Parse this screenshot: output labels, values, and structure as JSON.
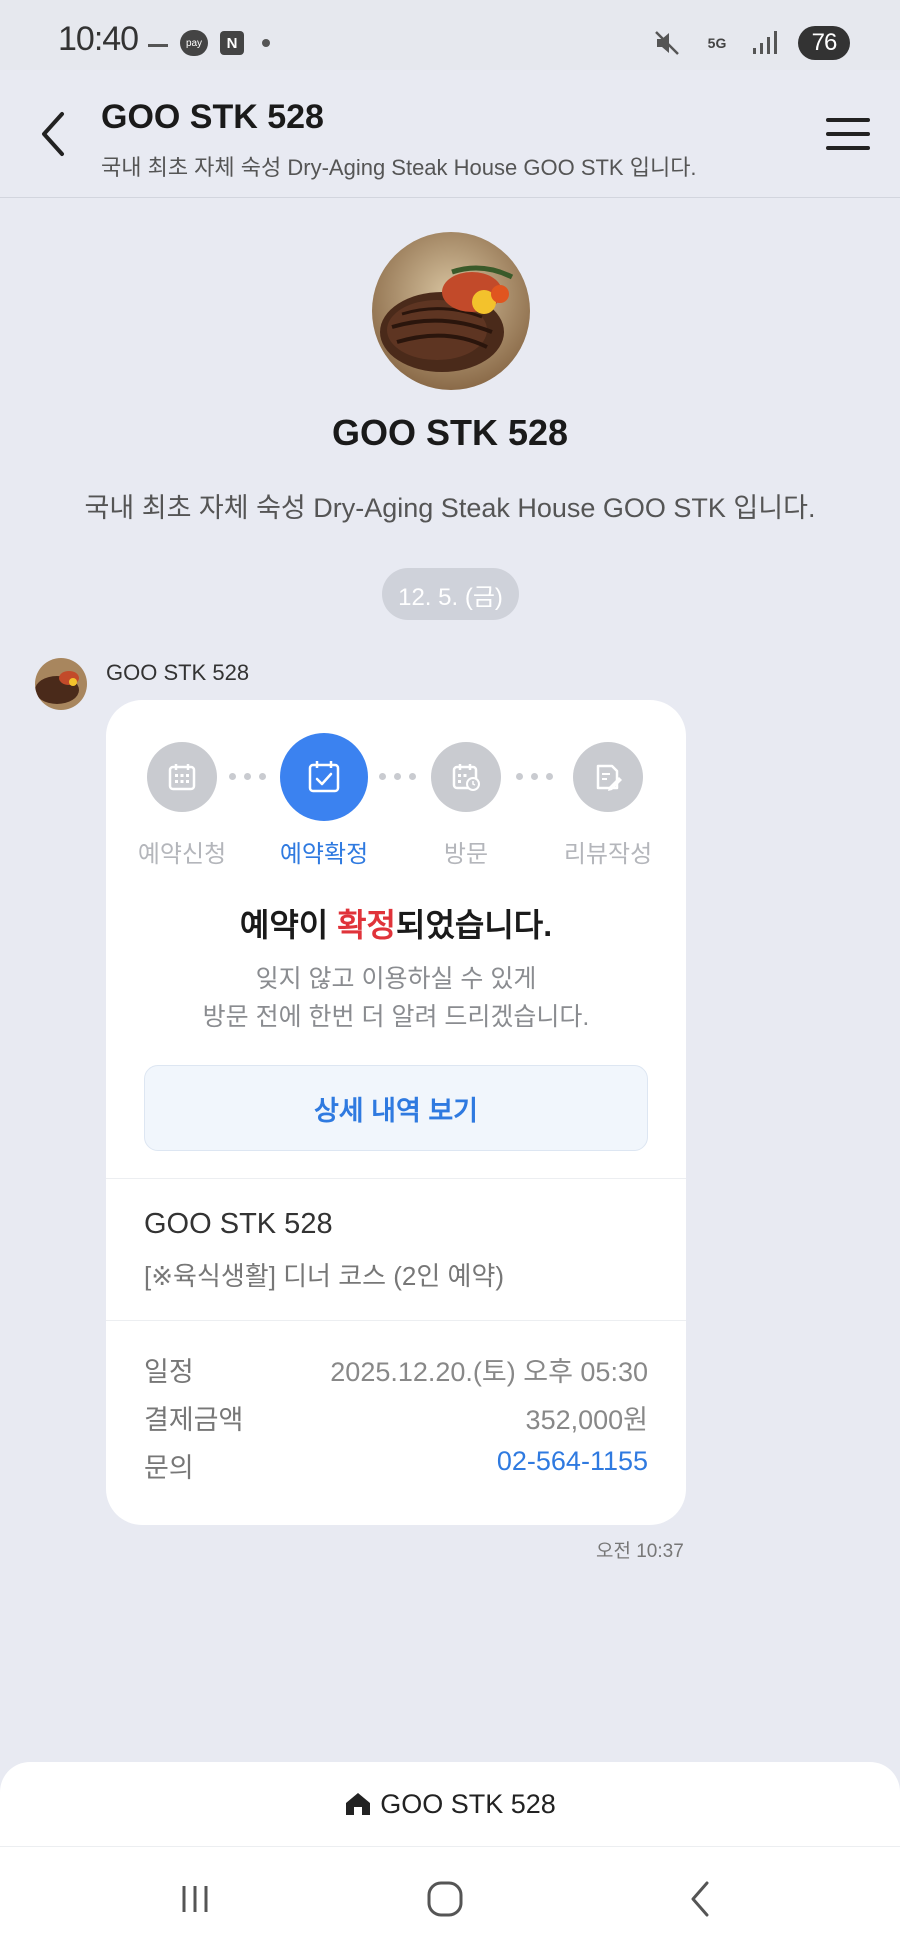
{
  "status_bar": {
    "time": "10:40",
    "pay_label": "pay",
    "n_label": "N",
    "network": "5G",
    "battery": "76",
    "icons": [
      "dash-icon",
      "pay-icon",
      "naver-icon",
      "dot-icon",
      "mute-icon",
      "5g-icon",
      "signal-icon",
      "battery-icon"
    ]
  },
  "header": {
    "title": "GOO STK 528",
    "subtitle": "국내 최초 자체 숙성 Dry-Aging Steak House GOO STK 입니다.",
    "back_icon": "back-arrow-icon",
    "menu_icon": "hamburger-menu-icon"
  },
  "profile": {
    "name": "GOO STK 528",
    "description": "국내 최초 자체 숙성 Dry-Aging Steak House GOO STK 입니다."
  },
  "date_separator": "12. 5. (금)",
  "message": {
    "sender": "GOO STK 528",
    "time": "오전 10:37",
    "steps": [
      {
        "label": "예약신청",
        "icon": "calendar-icon",
        "active": false
      },
      {
        "label": "예약확정",
        "icon": "calendar-check-icon",
        "active": true
      },
      {
        "label": "방문",
        "icon": "calendar-clock-icon",
        "active": false
      },
      {
        "label": "리뷰작성",
        "icon": "edit-note-icon",
        "active": false
      }
    ],
    "title_pre": "예약이 ",
    "title_highlight": "확정",
    "title_post": "되었습니다.",
    "body_line1": "잊지 않고 이용하실 수 있게",
    "body_line2": "방문 전에 한번 더 알려 드리겠습니다.",
    "detail_button": "상세 내역 보기",
    "business_name": "GOO STK 528",
    "course": "[※육식생활] 디너 코스 (2인 예약)",
    "info": [
      {
        "key": "일정",
        "value": "2025.12.20.(토) 오후 05:30"
      },
      {
        "key": "결제금액",
        "value": "352,000원"
      },
      {
        "key": "문의",
        "value": "02-564-1155"
      }
    ]
  },
  "bottom_bar": {
    "label": "GOO STK 528",
    "icon": "home-icon"
  },
  "colors": {
    "accent": "#3b82f0",
    "highlight": "#e0333a",
    "background": "#e8eaf2"
  }
}
